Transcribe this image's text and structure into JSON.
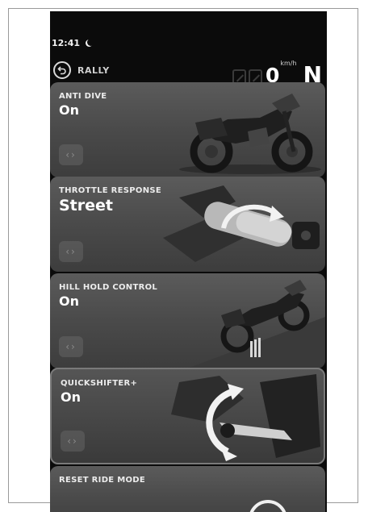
{
  "status": {
    "time": "12:41"
  },
  "header": {
    "mode": "RALLY",
    "speed": "0",
    "speed_unit": "km/h",
    "gear": "N"
  },
  "cards": [
    {
      "title": "ANTI DIVE",
      "value": "On",
      "nav": "‹›"
    },
    {
      "title": "THROTTLE RESPONSE",
      "value": "Street",
      "nav": "‹›"
    },
    {
      "title": "HILL HOLD CONTROL",
      "value": "On",
      "nav": "‹›"
    },
    {
      "title": "QUICKSHIFTER+",
      "value": "On",
      "nav": "‹›"
    },
    {
      "title": "RESET RIDE MODE"
    }
  ],
  "colors": {
    "screen_bg": "#0b0b0b",
    "card_bg": "#4a4a4a",
    "text": "#ffffff"
  }
}
